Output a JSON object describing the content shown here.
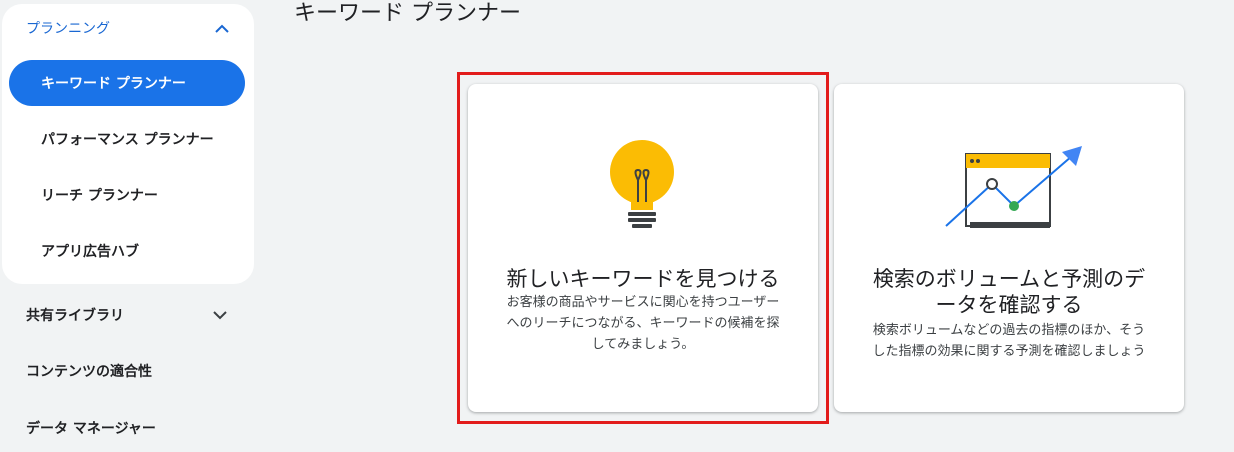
{
  "sidebar": {
    "section": {
      "label": "プランニング"
    },
    "items": [
      {
        "label": "キーワード プランナー"
      },
      {
        "label": "パフォーマンス プランナー"
      },
      {
        "label": "リーチ プランナー"
      },
      {
        "label": "アプリ広告ハブ"
      }
    ],
    "lower": [
      {
        "label": "共有ライブラリ"
      },
      {
        "label": "コンテンツの適合性"
      },
      {
        "label": "データ マネージャー"
      }
    ]
  },
  "main": {
    "title": "キーワード プランナー",
    "cards": [
      {
        "title": "新しいキーワードを見つける",
        "desc_lines": [
          "お客様の商品やサービスに関心を持つユーザー",
          "へのリーチにつながる、キーワードの候補を探",
          "してみましょう。"
        ],
        "icon": "lightbulb-icon"
      },
      {
        "title_lines": [
          "検索のボリュームと予測のデ",
          "ータを確認する"
        ],
        "desc_lines": [
          "検索ボリュームなどの過去の指標のほか、そう",
          "した指標の効果に関する予測を確認しましょう"
        ],
        "icon": "trend-chart-icon"
      }
    ]
  },
  "colors": {
    "accent": "#1a73e8",
    "highlight": "#e21b1b",
    "bulb": "#fbbc04",
    "green": "#34a853"
  }
}
